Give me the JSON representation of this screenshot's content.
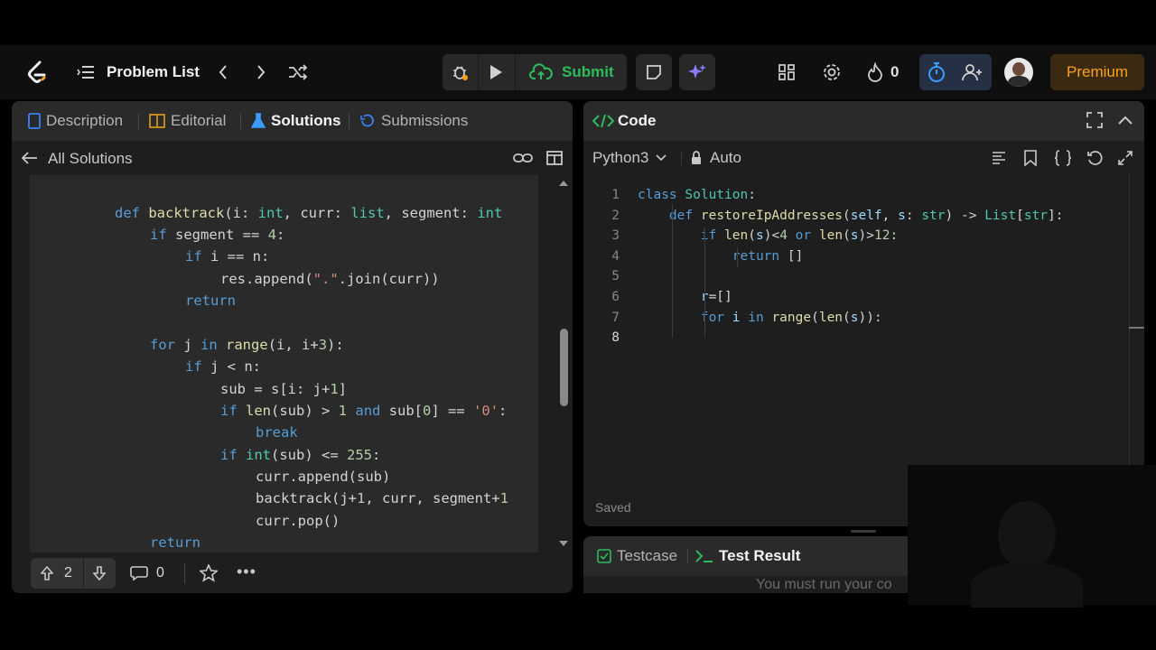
{
  "nav": {
    "problem_list": "Problem List",
    "submit": "Submit",
    "fire_count": "0",
    "premium": "Premium"
  },
  "left": {
    "tabs": [
      "Description",
      "Editorial",
      "Solutions",
      "Submissions"
    ],
    "all_solutions": "All Solutions",
    "upvotes": "2",
    "comments": "0"
  },
  "right": {
    "title": "Code",
    "language": "Python3",
    "mode": "Auto",
    "saved": "Saved",
    "bottom_tabs": [
      "Testcase",
      "Test Result"
    ],
    "run_message": "You must run your co"
  },
  "solution_code": [
    "def backtrack(i: int, curr: list, segment: int",
    "    if segment == 4:",
    "        if i == n:",
    "            res.append(\".\".join(curr))",
    "        return",
    "",
    "    for j in range(i, i+3):",
    "        if j < n:",
    "            sub = s[i: j+1]",
    "            if len(sub) > 1 and sub[0] == '0':",
    "                break",
    "            if int(sub) <= 255:",
    "                curr.append(sub)",
    "                backtrack(j+1, curr, segment+1",
    "                curr.pop()",
    "    return"
  ],
  "editor_code": [
    {
      "n": "1",
      "text": "class Solution:"
    },
    {
      "n": "2",
      "text": "    def restoreIpAddresses(self, s: str) -> List[str]:"
    },
    {
      "n": "3",
      "text": "        if len(s)<4 or len(s)>12:"
    },
    {
      "n": "4",
      "text": "            return []"
    },
    {
      "n": "5",
      "text": ""
    },
    {
      "n": "6",
      "text": "        r=[]"
    },
    {
      "n": "7",
      "text": "        for i in range(len(s)):"
    },
    {
      "n": "8",
      "text": ""
    }
  ],
  "colors": {
    "accent_blue": "#3b9cff",
    "submit_green": "#2cbb5d",
    "premium_gold": "#ffa116"
  }
}
